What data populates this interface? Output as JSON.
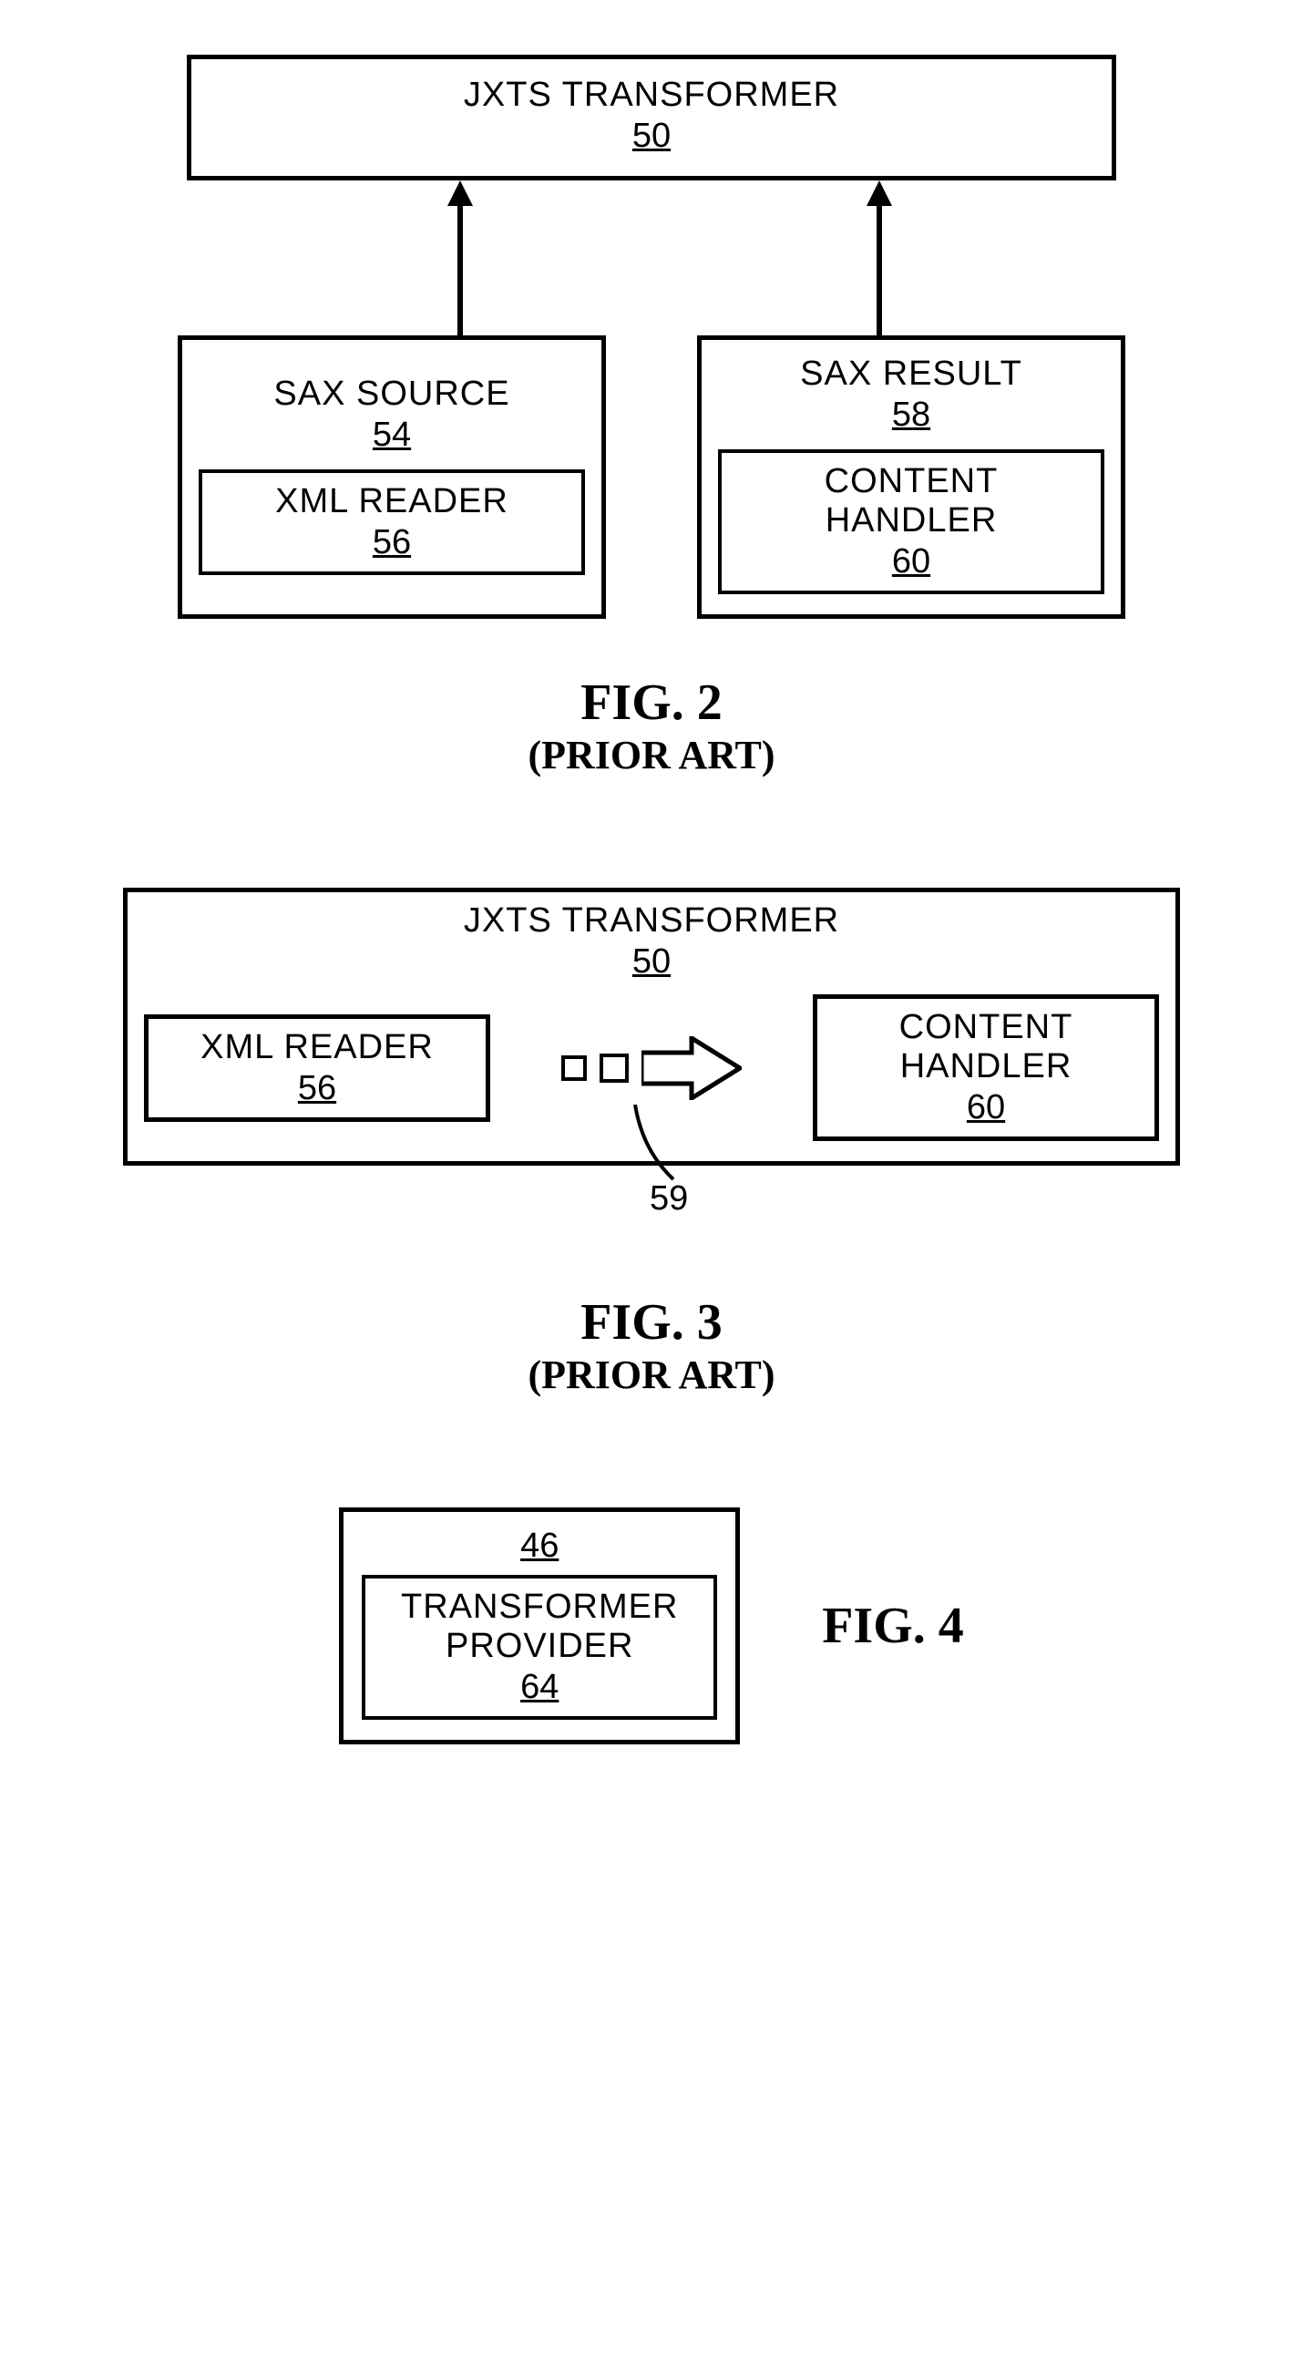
{
  "fig2": {
    "transformer": {
      "title": "JXTS TRANSFORMER",
      "ref": "50"
    },
    "sax_source": {
      "title": "SAX SOURCE",
      "ref": "54"
    },
    "xml_reader": {
      "title": "XML READER",
      "ref": "56"
    },
    "sax_result": {
      "title": "SAX RESULT",
      "ref": "58"
    },
    "content_handler": {
      "title": "CONTENT HANDLER",
      "ref": "60"
    },
    "figure_label": "FIG. 2",
    "figure_sub": "(PRIOR ART)"
  },
  "fig3": {
    "transformer": {
      "title": "JXTS TRANSFORMER",
      "ref": "50"
    },
    "xml_reader": {
      "title": "XML READER",
      "ref": "56"
    },
    "content_handler": {
      "title": "CONTENT HANDLER",
      "ref": "60"
    },
    "callout_ref": "59",
    "figure_label": "FIG. 3",
    "figure_sub": "(PRIOR ART)"
  },
  "fig4": {
    "outer_ref": "46",
    "provider": {
      "title_line1": "TRANSFORMER",
      "title_line2": "PROVIDER",
      "ref": "64"
    },
    "figure_label": "FIG. 4"
  }
}
